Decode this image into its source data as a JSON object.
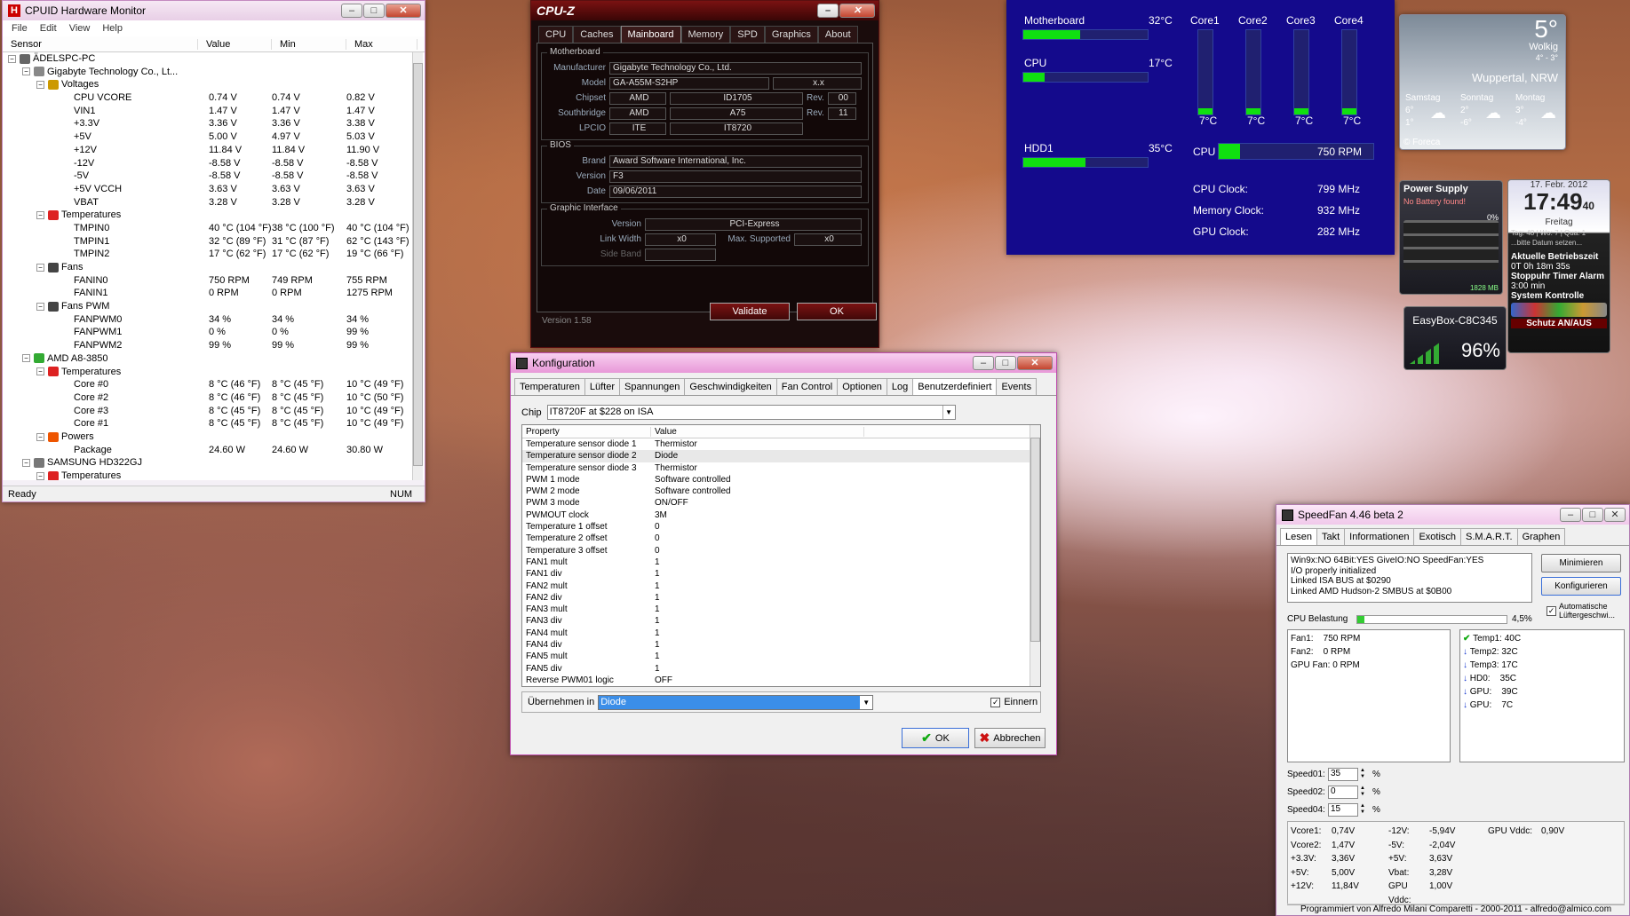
{
  "hwmonitor": {
    "title": "CPUID Hardware Monitor",
    "menu": [
      "File",
      "Edit",
      "View",
      "Help"
    ],
    "columns": [
      "Sensor",
      "Value",
      "Min",
      "Max"
    ],
    "rows": [
      {
        "lvl": 0,
        "t": "ÄDELSPC-PC",
        "v": "",
        "mn": "",
        "mx": "",
        "tog": "-",
        "ico": "pc"
      },
      {
        "lvl": 1,
        "t": "Gigabyte Technology Co., Lt...",
        "v": "",
        "mn": "",
        "mx": "",
        "tog": "-",
        "ico": "mb"
      },
      {
        "lvl": 2,
        "t": "Voltages",
        "v": "",
        "mn": "",
        "mx": "",
        "tog": "-",
        "ico": "volt"
      },
      {
        "lvl": 3,
        "t": "CPU VCORE",
        "v": "0.74 V",
        "mn": "0.74 V",
        "mx": "0.82 V"
      },
      {
        "lvl": 3,
        "t": "VIN1",
        "v": "1.47 V",
        "mn": "1.47 V",
        "mx": "1.47 V"
      },
      {
        "lvl": 3,
        "t": "+3.3V",
        "v": "3.36 V",
        "mn": "3.36 V",
        "mx": "3.38 V"
      },
      {
        "lvl": 3,
        "t": "+5V",
        "v": "5.00 V",
        "mn": "4.97 V",
        "mx": "5.03 V"
      },
      {
        "lvl": 3,
        "t": "+12V",
        "v": "11.84 V",
        "mn": "11.84 V",
        "mx": "11.90 V"
      },
      {
        "lvl": 3,
        "t": "-12V",
        "v": "-8.58 V",
        "mn": "-8.58 V",
        "mx": "-8.58 V"
      },
      {
        "lvl": 3,
        "t": "-5V",
        "v": "-8.58 V",
        "mn": "-8.58 V",
        "mx": "-8.58 V"
      },
      {
        "lvl": 3,
        "t": "+5V VCCH",
        "v": "3.63 V",
        "mn": "3.63 V",
        "mx": "3.63 V"
      },
      {
        "lvl": 3,
        "t": "VBAT",
        "v": "3.28 V",
        "mn": "3.28 V",
        "mx": "3.28 V"
      },
      {
        "lvl": 2,
        "t": "Temperatures",
        "v": "",
        "mn": "",
        "mx": "",
        "tog": "-",
        "ico": "temp"
      },
      {
        "lvl": 3,
        "t": "TMPIN0",
        "v": "40 °C (104 °F)",
        "mn": "38 °C (100 °F)",
        "mx": "40 °C (104 °F)"
      },
      {
        "lvl": 3,
        "t": "TMPIN1",
        "v": "32 °C (89 °F)",
        "mn": "31 °C (87 °F)",
        "mx": "62 °C (143 °F)"
      },
      {
        "lvl": 3,
        "t": "TMPIN2",
        "v": "17 °C (62 °F)",
        "mn": "17 °C (62 °F)",
        "mx": "19 °C (66 °F)"
      },
      {
        "lvl": 2,
        "t": "Fans",
        "v": "",
        "mn": "",
        "mx": "",
        "tog": "-",
        "ico": "fan"
      },
      {
        "lvl": 3,
        "t": "FANIN0",
        "v": "750 RPM",
        "mn": "749 RPM",
        "mx": "755 RPM"
      },
      {
        "lvl": 3,
        "t": "FANIN1",
        "v": "0 RPM",
        "mn": "0 RPM",
        "mx": "1275 RPM"
      },
      {
        "lvl": 2,
        "t": "Fans PWM",
        "v": "",
        "mn": "",
        "mx": "",
        "tog": "-",
        "ico": "fan"
      },
      {
        "lvl": 3,
        "t": "FANPWM0",
        "v": "34 %",
        "mn": "34 %",
        "mx": "34 %"
      },
      {
        "lvl": 3,
        "t": "FANPWM1",
        "v": "0 %",
        "mn": "0 %",
        "mx": "99 %"
      },
      {
        "lvl": 3,
        "t": "FANPWM2",
        "v": "99 %",
        "mn": "99 %",
        "mx": "99 %"
      },
      {
        "lvl": 1,
        "t": "AMD A8-3850",
        "v": "",
        "mn": "",
        "mx": "",
        "tog": "-",
        "ico": "chip"
      },
      {
        "lvl": 2,
        "t": "Temperatures",
        "v": "",
        "mn": "",
        "mx": "",
        "tog": "-",
        "ico": "temp"
      },
      {
        "lvl": 3,
        "t": "Core #0",
        "v": "8 °C (46 °F)",
        "mn": "8 °C (45 °F)",
        "mx": "10 °C (49 °F)"
      },
      {
        "lvl": 3,
        "t": "Core #2",
        "v": "8 °C (46 °F)",
        "mn": "8 °C (45 °F)",
        "mx": "10 °C (50 °F)"
      },
      {
        "lvl": 3,
        "t": "Core #3",
        "v": "8 °C (45 °F)",
        "mn": "8 °C (45 °F)",
        "mx": "10 °C (49 °F)"
      },
      {
        "lvl": 3,
        "t": "Core #1",
        "v": "8 °C (45 °F)",
        "mn": "8 °C (45 °F)",
        "mx": "10 °C (49 °F)"
      },
      {
        "lvl": 2,
        "t": "Powers",
        "v": "",
        "mn": "",
        "mx": "",
        "tog": "-",
        "ico": "power"
      },
      {
        "lvl": 3,
        "t": "Package",
        "v": "24.60 W",
        "mn": "24.60 W",
        "mx": "30.80 W"
      },
      {
        "lvl": 1,
        "t": "SAMSUNG HD322GJ",
        "v": "",
        "mn": "",
        "mx": "",
        "tog": "-",
        "ico": "hdd"
      },
      {
        "lvl": 2,
        "t": "Temperatures",
        "v": "",
        "mn": "",
        "mx": "",
        "tog": "-",
        "ico": "temp"
      }
    ],
    "status": "Ready",
    "num": "NUM"
  },
  "cpuz": {
    "title": "CPU-Z",
    "tabs": [
      "CPU",
      "Caches",
      "Mainboard",
      "Memory",
      "SPD",
      "Graphics",
      "About"
    ],
    "active_tab": "Mainboard",
    "mb_legend": "Motherboard",
    "manufacturer_l": "Manufacturer",
    "manufacturer": "Gigabyte Technology Co., Ltd.",
    "model_l": "Model",
    "model": "GA-A55M-S2HP",
    "model_rev": "x.x",
    "chipset_l": "Chipset",
    "chipset": "AMD",
    "chipset_id": "ID1705",
    "rev_l": "Rev.",
    "chipset_rev": "00",
    "south_l": "Southbridge",
    "south": "AMD",
    "south_id": "A75",
    "south_rev": "11",
    "lpcio_l": "LPCIO",
    "lpcio": "ITE",
    "lpcio_id": "IT8720",
    "bios_legend": "BIOS",
    "brand_l": "Brand",
    "brand": "Award Software International, Inc.",
    "version_l": "Version",
    "version": "F3",
    "date_l": "Date",
    "date": "09/06/2011",
    "gi_legend": "Graphic Interface",
    "gi_version_l": "Version",
    "gi_version": "PCI-Express",
    "linkw_l": "Link Width",
    "linkw": "x0",
    "maxs_l": "Max. Supported",
    "maxs": "x0",
    "side_l": "Side Band",
    "validate": "Validate",
    "ok": "OK",
    "footer": "Version 1.58"
  },
  "widget": {
    "mb_l": "Motherboard",
    "mb_t": "32°C",
    "mb_pct": 0.46,
    "cpu_l": "CPU",
    "cpu_t": "17°C",
    "cpu_pct": 0.17,
    "hdd_l": "HDD1",
    "hdd_t": "35°C",
    "hdd_pct": 0.5,
    "cores": [
      {
        "l": "Core1",
        "t": "7°C",
        "p": 0.07
      },
      {
        "l": "Core2",
        "t": "7°C",
        "p": 0.07
      },
      {
        "l": "Core3",
        "t": "7°C",
        "p": 0.07
      },
      {
        "l": "Core4",
        "t": "7°C",
        "p": 0.07
      }
    ],
    "fan_l": "CPU",
    "fan_v": "750 RPM",
    "fan_pct": 0.14,
    "clk": [
      {
        "l": "CPU Clock:",
        "v": "799 MHz"
      },
      {
        "l": "Memory Clock:",
        "v": "932 MHz"
      },
      {
        "l": "GPU Clock:",
        "v": "282 MHz"
      }
    ]
  },
  "weather": {
    "temp": "5°",
    "cond": "Wolkig",
    "range": "4° - 3°",
    "city": "Wuppertal, NRW",
    "days": [
      {
        "d": "Samstag",
        "h": "6°",
        "l": "1°"
      },
      {
        "d": "Sonntag",
        "h": "2°",
        "l": "-6°"
      },
      {
        "d": "Montag",
        "h": "3°",
        "l": "-4°"
      }
    ],
    "src": "© Foreca"
  },
  "power": {
    "title": "Power Supply",
    "sub": "No Battery found!",
    "pct": "0%",
    "mb": "1828 MB"
  },
  "clock": {
    "date": "17. Febr. 2012",
    "time": "17:49",
    "sec": "40",
    "day": "Freitag",
    "info": "Tag: 48 | Wo: 7 | Qua: 1",
    "hint": "...bitte Datum setzen...",
    "up_l": "Aktuelle Betriebszeit",
    "up": "0T 0h 18m 35s",
    "timer": "Stoppuhr Timer Alarm",
    "min": "3:00 min",
    "ctrl": "System Kontrolle",
    "prot": "Schutz AN/AUS"
  },
  "wifi": {
    "name": "EasyBox-C8C345",
    "pct": "96%"
  },
  "konf": {
    "title": "Konfiguration",
    "tabs": [
      "Temperaturen",
      "Lüfter",
      "Spannungen",
      "Geschwindigkeiten",
      "Fan Control",
      "Optionen",
      "Log",
      "Benutzerdefiniert",
      "Events"
    ],
    "active_tab": "Benutzerdefiniert",
    "chip_l": "Chip",
    "chip": "IT8720F at $228 on ISA",
    "col_p": "Property",
    "col_v": "Value",
    "rows": [
      [
        "Temperature sensor diode 1",
        "Thermistor"
      ],
      [
        "Temperature sensor diode 2",
        "Diode"
      ],
      [
        "Temperature sensor diode 3",
        "Thermistor"
      ],
      [
        "PWM 1 mode",
        "Software controlled"
      ],
      [
        "PWM 2 mode",
        "Software controlled"
      ],
      [
        "PWM 3 mode",
        "ON/OFF"
      ],
      [
        "PWMOUT clock",
        "3M"
      ],
      [
        "Temperature 1 offset",
        "0"
      ],
      [
        "Temperature 2 offset",
        "0"
      ],
      [
        "Temperature 3 offset",
        "0"
      ],
      [
        "FAN1 mult",
        "1"
      ],
      [
        "FAN1 div",
        "1"
      ],
      [
        "FAN2 mult",
        "1"
      ],
      [
        "FAN2 div",
        "1"
      ],
      [
        "FAN3 mult",
        "1"
      ],
      [
        "FAN3 div",
        "1"
      ],
      [
        "FAN4 mult",
        "1"
      ],
      [
        "FAN4 div",
        "1"
      ],
      [
        "FAN5 mult",
        "1"
      ],
      [
        "FAN5 div",
        "1"
      ],
      [
        "Reverse PWM01 logic",
        "OFF"
      ]
    ],
    "apply_l": "Übernehmen in",
    "apply": "Diode",
    "remember": "Einnern",
    "ok": "OK",
    "cancel": "Abbrechen"
  },
  "speedfan": {
    "title": "SpeedFan 4.46 beta 2",
    "tabs": [
      "Lesen",
      "Takt",
      "Informationen",
      "Exotisch",
      "S.M.A.R.T.",
      "Graphen"
    ],
    "log": [
      "Win9x:NO  64Bit:YES  GiveIO:NO  SpeedFan:YES",
      "I/O properly initialized",
      "Linked ISA BUS at $0290",
      "Linked AMD Hudson-2 SMBUS at $0B00"
    ],
    "btn_min": "Minimieren",
    "btn_conf": "Konfigurieren",
    "auto": "Automatische Lüftergeschwi...",
    "load_l": "CPU Belastung",
    "load": "4,5%",
    "fans": [
      "Fan1:    750 RPM",
      "Fan2:    0 RPM",
      "GPU Fan: 0 RPM"
    ],
    "temps": [
      {
        "t": "Temp1: 40C",
        "i": "check"
      },
      {
        "t": "Temp2: 32C",
        "i": "down"
      },
      {
        "t": "Temp3: 17C",
        "i": "down"
      },
      {
        "t": "HD0:    35C",
        "i": "down"
      },
      {
        "t": "GPU:    39C",
        "i": "down"
      },
      {
        "t": "GPU:    7C",
        "i": "down"
      }
    ],
    "speeds": [
      {
        "l": "Speed01:",
        "v": "35"
      },
      {
        "l": "Speed02:",
        "v": "0"
      },
      {
        "l": "Speed04:",
        "v": "15"
      }
    ],
    "pct": "%",
    "volt": [
      [
        "Vcore1:",
        "0,74V",
        "-12V:",
        "-5,94V",
        "GPU Vddc:",
        "0,90V"
      ],
      [
        "Vcore2:",
        "1,47V",
        "-5V:",
        "-2,04V",
        "",
        ""
      ],
      [
        "+3.3V:",
        "3,36V",
        "+5V:",
        "3,63V",
        "",
        ""
      ],
      [
        "+5V:",
        "5,00V",
        "Vbat:",
        "3,28V",
        "",
        ""
      ],
      [
        "+12V:",
        "11,84V",
        "GPU Vddc:",
        "1,00V",
        "",
        ""
      ]
    ],
    "footer": "Programmiert von Alfredo Milani Comparetti - 2000-2011 - alfredo@almico.com"
  }
}
